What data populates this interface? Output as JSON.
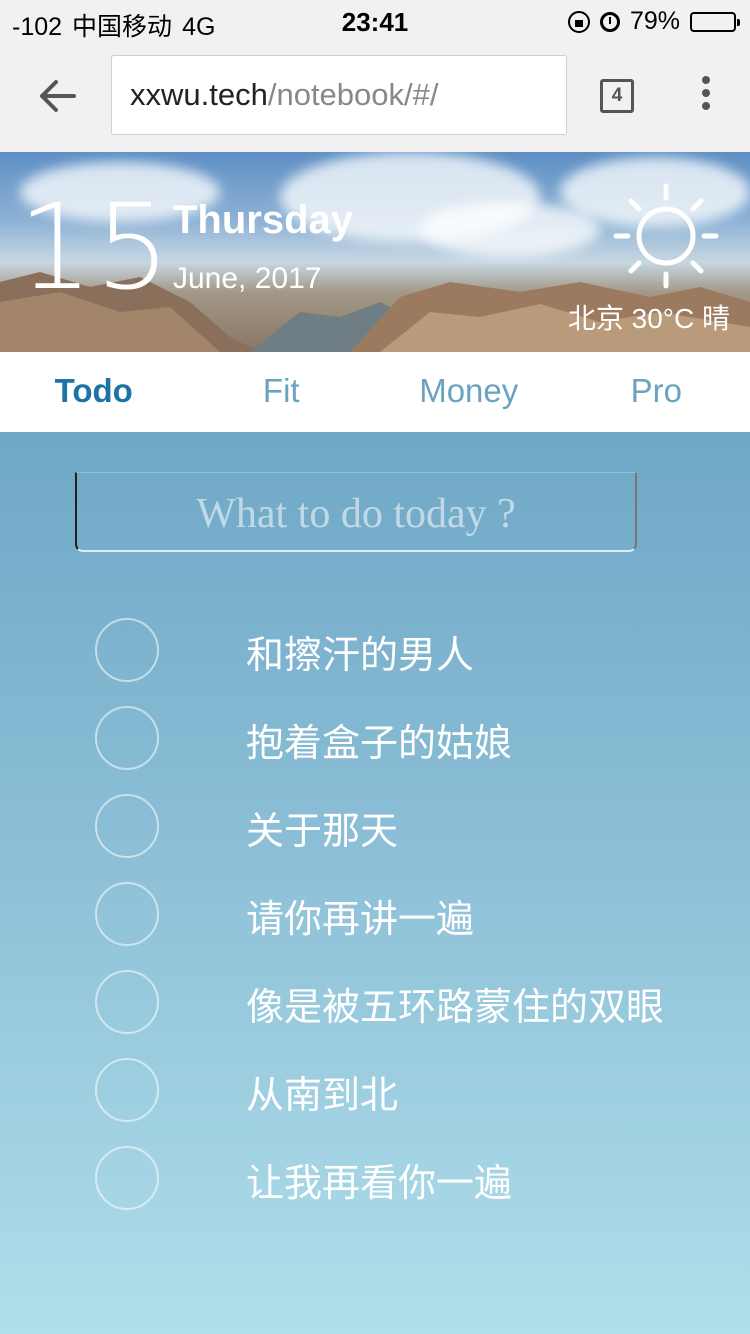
{
  "status_bar": {
    "signal": "-102",
    "carrier": "中国移动",
    "network": "4G",
    "time": "23:41",
    "battery": "79%",
    "battery_level": 0.79
  },
  "browser": {
    "url_host": "xxwu.tech",
    "url_path": "/notebook/#/",
    "tab_count": "4"
  },
  "header": {
    "day": "15",
    "weekday": "Thursday",
    "month_year": "June, 2017",
    "weather": "北京 30°C 晴",
    "weather_icon": "sun-icon"
  },
  "tabs": [
    {
      "label": "Todo",
      "active": true
    },
    {
      "label": "Fit",
      "active": false
    },
    {
      "label": "Money",
      "active": false
    },
    {
      "label": "Pro",
      "active": false
    }
  ],
  "todo": {
    "placeholder": "What to do today ?",
    "items": [
      {
        "text": "和擦汗的男人"
      },
      {
        "text": "抱着盒子的姑娘"
      },
      {
        "text": "关于那天"
      },
      {
        "text": "请你再讲一遍"
      },
      {
        "text": "像是被五环路蒙住的双眼"
      },
      {
        "text": "从南到北"
      },
      {
        "text": "让我再看你一遍"
      }
    ]
  },
  "colors": {
    "accent": "#1b73a6",
    "tab_inactive": "#6aa3c0",
    "gradient_top": "#6ea7c6",
    "gradient_bottom": "#b0dfea"
  }
}
